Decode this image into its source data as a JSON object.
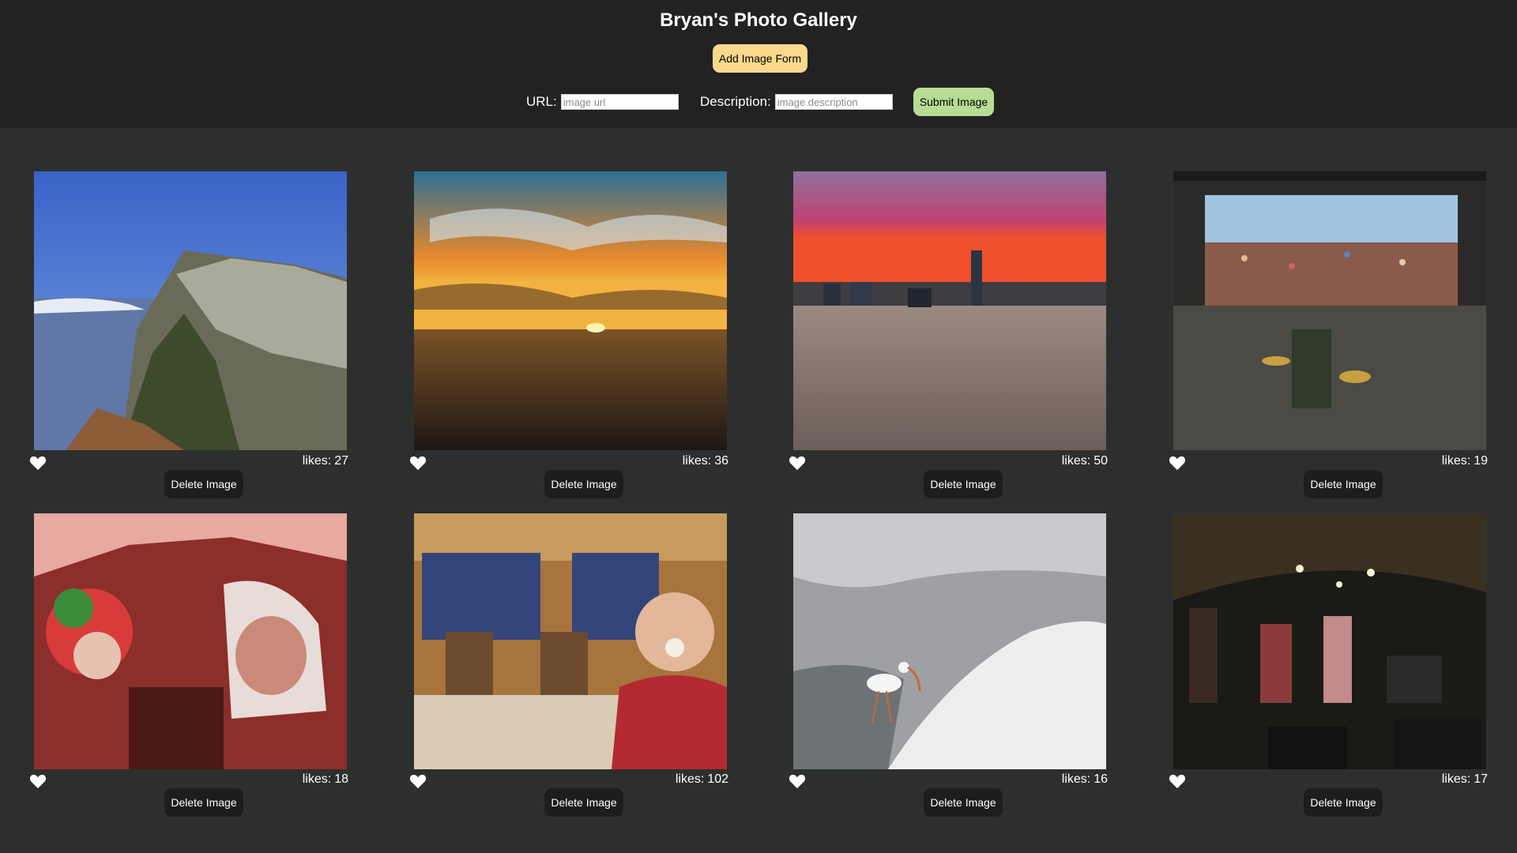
{
  "header": {
    "title": "Bryan's Photo Gallery",
    "add_form_label": "Add Image Form",
    "url_label": "URL:",
    "url_placeholder": "image url",
    "url_value": "",
    "description_label": "Description:",
    "description_placeholder": "image description",
    "description_value": "",
    "submit_label": "Submit Image"
  },
  "colors": {
    "header_bg": "#222222",
    "page_bg": "#2d2f2f",
    "add_form_button": "#fbd88c",
    "submit_button": "#b7dd95",
    "delete_button": "#1d1d1d"
  },
  "gallery": {
    "likes_label": "likes:",
    "delete_label": "Delete Image",
    "heart_icon": "heart-icon",
    "images": [
      {
        "likes": "27",
        "subject": "cliff-mountain"
      },
      {
        "likes": "36",
        "subject": "ocean-sunset"
      },
      {
        "likes": "50",
        "subject": "sunset-hilltop-people"
      },
      {
        "likes": "19",
        "subject": "festival-stage-band"
      },
      {
        "likes": "18",
        "subject": "costumed-clowns-astronaut"
      },
      {
        "likes": "102",
        "subject": "toddler-living-room"
      },
      {
        "likes": "16",
        "subject": "ibis-beach"
      },
      {
        "likes": "17",
        "subject": "band-concert-stage"
      }
    ]
  }
}
